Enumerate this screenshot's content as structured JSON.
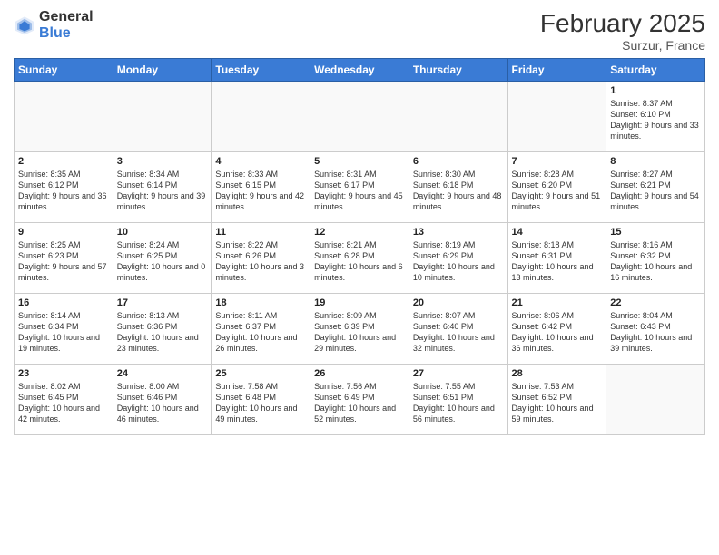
{
  "header": {
    "logo_general": "General",
    "logo_blue": "Blue",
    "month_title": "February 2025",
    "location": "Surzur, France"
  },
  "columns": [
    "Sunday",
    "Monday",
    "Tuesday",
    "Wednesday",
    "Thursday",
    "Friday",
    "Saturday"
  ],
  "weeks": [
    [
      {
        "day": "",
        "info": ""
      },
      {
        "day": "",
        "info": ""
      },
      {
        "day": "",
        "info": ""
      },
      {
        "day": "",
        "info": ""
      },
      {
        "day": "",
        "info": ""
      },
      {
        "day": "",
        "info": ""
      },
      {
        "day": "1",
        "info": "Sunrise: 8:37 AM\nSunset: 6:10 PM\nDaylight: 9 hours and 33 minutes."
      }
    ],
    [
      {
        "day": "2",
        "info": "Sunrise: 8:35 AM\nSunset: 6:12 PM\nDaylight: 9 hours and 36 minutes."
      },
      {
        "day": "3",
        "info": "Sunrise: 8:34 AM\nSunset: 6:14 PM\nDaylight: 9 hours and 39 minutes."
      },
      {
        "day": "4",
        "info": "Sunrise: 8:33 AM\nSunset: 6:15 PM\nDaylight: 9 hours and 42 minutes."
      },
      {
        "day": "5",
        "info": "Sunrise: 8:31 AM\nSunset: 6:17 PM\nDaylight: 9 hours and 45 minutes."
      },
      {
        "day": "6",
        "info": "Sunrise: 8:30 AM\nSunset: 6:18 PM\nDaylight: 9 hours and 48 minutes."
      },
      {
        "day": "7",
        "info": "Sunrise: 8:28 AM\nSunset: 6:20 PM\nDaylight: 9 hours and 51 minutes."
      },
      {
        "day": "8",
        "info": "Sunrise: 8:27 AM\nSunset: 6:21 PM\nDaylight: 9 hours and 54 minutes."
      }
    ],
    [
      {
        "day": "9",
        "info": "Sunrise: 8:25 AM\nSunset: 6:23 PM\nDaylight: 9 hours and 57 minutes."
      },
      {
        "day": "10",
        "info": "Sunrise: 8:24 AM\nSunset: 6:25 PM\nDaylight: 10 hours and 0 minutes."
      },
      {
        "day": "11",
        "info": "Sunrise: 8:22 AM\nSunset: 6:26 PM\nDaylight: 10 hours and 3 minutes."
      },
      {
        "day": "12",
        "info": "Sunrise: 8:21 AM\nSunset: 6:28 PM\nDaylight: 10 hours and 6 minutes."
      },
      {
        "day": "13",
        "info": "Sunrise: 8:19 AM\nSunset: 6:29 PM\nDaylight: 10 hours and 10 minutes."
      },
      {
        "day": "14",
        "info": "Sunrise: 8:18 AM\nSunset: 6:31 PM\nDaylight: 10 hours and 13 minutes."
      },
      {
        "day": "15",
        "info": "Sunrise: 8:16 AM\nSunset: 6:32 PM\nDaylight: 10 hours and 16 minutes."
      }
    ],
    [
      {
        "day": "16",
        "info": "Sunrise: 8:14 AM\nSunset: 6:34 PM\nDaylight: 10 hours and 19 minutes."
      },
      {
        "day": "17",
        "info": "Sunrise: 8:13 AM\nSunset: 6:36 PM\nDaylight: 10 hours and 23 minutes."
      },
      {
        "day": "18",
        "info": "Sunrise: 8:11 AM\nSunset: 6:37 PM\nDaylight: 10 hours and 26 minutes."
      },
      {
        "day": "19",
        "info": "Sunrise: 8:09 AM\nSunset: 6:39 PM\nDaylight: 10 hours and 29 minutes."
      },
      {
        "day": "20",
        "info": "Sunrise: 8:07 AM\nSunset: 6:40 PM\nDaylight: 10 hours and 32 minutes."
      },
      {
        "day": "21",
        "info": "Sunrise: 8:06 AM\nSunset: 6:42 PM\nDaylight: 10 hours and 36 minutes."
      },
      {
        "day": "22",
        "info": "Sunrise: 8:04 AM\nSunset: 6:43 PM\nDaylight: 10 hours and 39 minutes."
      }
    ],
    [
      {
        "day": "23",
        "info": "Sunrise: 8:02 AM\nSunset: 6:45 PM\nDaylight: 10 hours and 42 minutes."
      },
      {
        "day": "24",
        "info": "Sunrise: 8:00 AM\nSunset: 6:46 PM\nDaylight: 10 hours and 46 minutes."
      },
      {
        "day": "25",
        "info": "Sunrise: 7:58 AM\nSunset: 6:48 PM\nDaylight: 10 hours and 49 minutes."
      },
      {
        "day": "26",
        "info": "Sunrise: 7:56 AM\nSunset: 6:49 PM\nDaylight: 10 hours and 52 minutes."
      },
      {
        "day": "27",
        "info": "Sunrise: 7:55 AM\nSunset: 6:51 PM\nDaylight: 10 hours and 56 minutes."
      },
      {
        "day": "28",
        "info": "Sunrise: 7:53 AM\nSunset: 6:52 PM\nDaylight: 10 hours and 59 minutes."
      },
      {
        "day": "",
        "info": ""
      }
    ]
  ]
}
